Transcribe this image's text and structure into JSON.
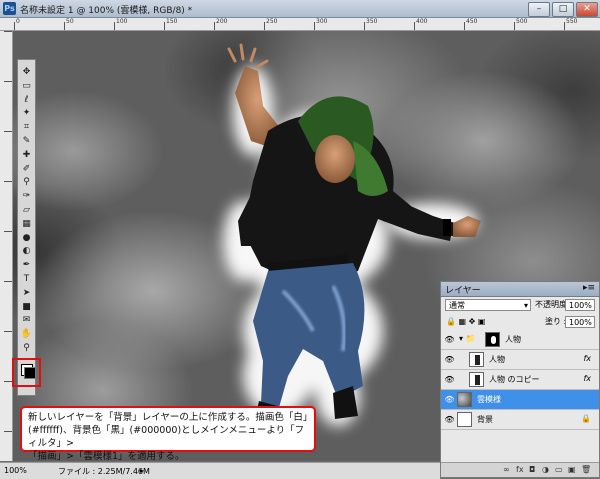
{
  "window": {
    "title": "名称未設定 1 @ 100% (雲模様, RGB/8) *",
    "buttons": {
      "minimize": "–",
      "maximize": "□",
      "close": "✕"
    }
  },
  "rulers": {
    "top_ticks": [
      "0",
      "50",
      "100",
      "150",
      "200",
      "250",
      "300",
      "350",
      "400",
      "450",
      "500",
      "550"
    ]
  },
  "tools": [
    {
      "name": "move-icon",
      "glyph": "✥"
    },
    {
      "name": "marquee-icon",
      "glyph": "▭"
    },
    {
      "name": "lasso-icon",
      "glyph": "ℓ"
    },
    {
      "name": "magic-wand-icon",
      "glyph": "✦"
    },
    {
      "name": "crop-icon",
      "glyph": "⌗"
    },
    {
      "name": "eyedropper-icon",
      "glyph": "✎"
    },
    {
      "name": "healing-icon",
      "glyph": "✚"
    },
    {
      "name": "brush-icon",
      "glyph": "✐"
    },
    {
      "name": "stamp-icon",
      "glyph": "⚲"
    },
    {
      "name": "history-brush-icon",
      "glyph": "✑"
    },
    {
      "name": "eraser-icon",
      "glyph": "▱"
    },
    {
      "name": "gradient-icon",
      "glyph": "▦"
    },
    {
      "name": "blur-icon",
      "glyph": "●"
    },
    {
      "name": "dodge-icon",
      "glyph": "◐"
    },
    {
      "name": "pen-icon",
      "glyph": "✒"
    },
    {
      "name": "type-icon",
      "glyph": "T"
    },
    {
      "name": "path-select-icon",
      "glyph": "➤"
    },
    {
      "name": "shape-icon",
      "glyph": "■"
    },
    {
      "name": "notes-icon",
      "glyph": "✉"
    },
    {
      "name": "hand-icon",
      "glyph": "✋"
    },
    {
      "name": "zoom-icon",
      "glyph": "⚲"
    }
  ],
  "layers_panel": {
    "title": "レイヤー",
    "blend_mode": "通常",
    "opacity_label": "不透明度 :",
    "opacity_value": "100%",
    "fill_label": "塗り :",
    "fill_value": "100%",
    "layers": [
      {
        "name": "人物",
        "visible": true,
        "fx": "",
        "active": false
      },
      {
        "name": "人物",
        "visible": true,
        "fx": "fx",
        "active": false
      },
      {
        "name": "人物 のコピー",
        "visible": true,
        "fx": "fx",
        "active": false
      },
      {
        "name": "雲模様",
        "visible": true,
        "fx": "",
        "active": true
      },
      {
        "name": "背景",
        "visible": true,
        "fx": "",
        "active": false
      }
    ],
    "bottom_icons": [
      "∞",
      "fx",
      "◘",
      "◑",
      "▭",
      "▣",
      "🗑"
    ]
  },
  "status_bar": {
    "zoom": "100%",
    "file_info": "ファイル : 2.25M/7.46M"
  },
  "caption": {
    "line1": "新しいレイヤーを「背景」レイヤーの上に作成する。描画色「白」",
    "line2": "(#ffffff)、背景色「黒」(#000000)としメインメニューより「フィルタ」>",
    "line3": "「描画」>「雲模様1」を適用する。"
  },
  "colors": {
    "highlight": "#e11010",
    "active_layer": "#3e90e8",
    "hoodie": "#1f4a1f",
    "jeans": "#3b5a86"
  }
}
